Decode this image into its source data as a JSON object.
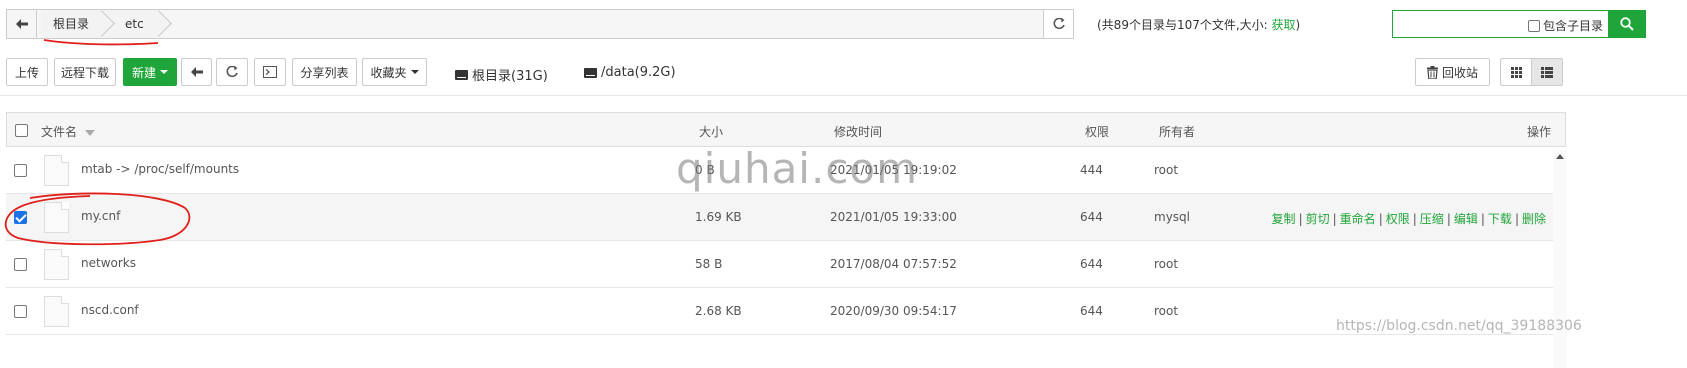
{
  "pathbar": {
    "crumbs": [
      "根目录",
      "etc"
    ],
    "info_prefix": "(共89个目录与107个文件,大小: ",
    "info_link": "获取",
    "info_suffix": ")"
  },
  "search": {
    "subdir_label": "包含子目录"
  },
  "toolbar": {
    "upload": "上传",
    "remote_download": "远程下载",
    "new": "新建",
    "share_list": "分享列表",
    "favorites": "收藏夹",
    "recycle_bin": "回收站",
    "disks": [
      {
        "label": "根目录(31G)"
      },
      {
        "label": "/data(9.2G)"
      }
    ]
  },
  "table": {
    "headers": {
      "name": "文件名",
      "size": "大小",
      "mtime": "修改时间",
      "perm": "权限",
      "owner": "所有者",
      "ops": "操作"
    },
    "rows": [
      {
        "name": "mtab -> /proc/self/mounts",
        "size": "0 B",
        "mtime": "2021/01/05 19:19:02",
        "perm": "444",
        "owner": "root",
        "checked": false
      },
      {
        "name": "my.cnf",
        "size": "1.69 KB",
        "mtime": "2021/01/05 19:33:00",
        "perm": "644",
        "owner": "mysql",
        "checked": true
      },
      {
        "name": "networks",
        "size": "58 B",
        "mtime": "2017/08/04 07:57:52",
        "perm": "644",
        "owner": "root",
        "checked": false
      },
      {
        "name": "nscd.conf",
        "size": "2.68 KB",
        "mtime": "2020/09/30 09:54:17",
        "perm": "644",
        "owner": "root",
        "checked": false
      }
    ],
    "row_ops": [
      "复制",
      "剪切",
      "重命名",
      "权限",
      "压缩",
      "编辑",
      "下载",
      "删除"
    ]
  },
  "watermarks": {
    "main": "qiuhai.com",
    "corner": "https://blog.csdn.net/qq_39188306"
  },
  "colors": {
    "accent": "#20a53a",
    "annotation": "#e0201a"
  }
}
